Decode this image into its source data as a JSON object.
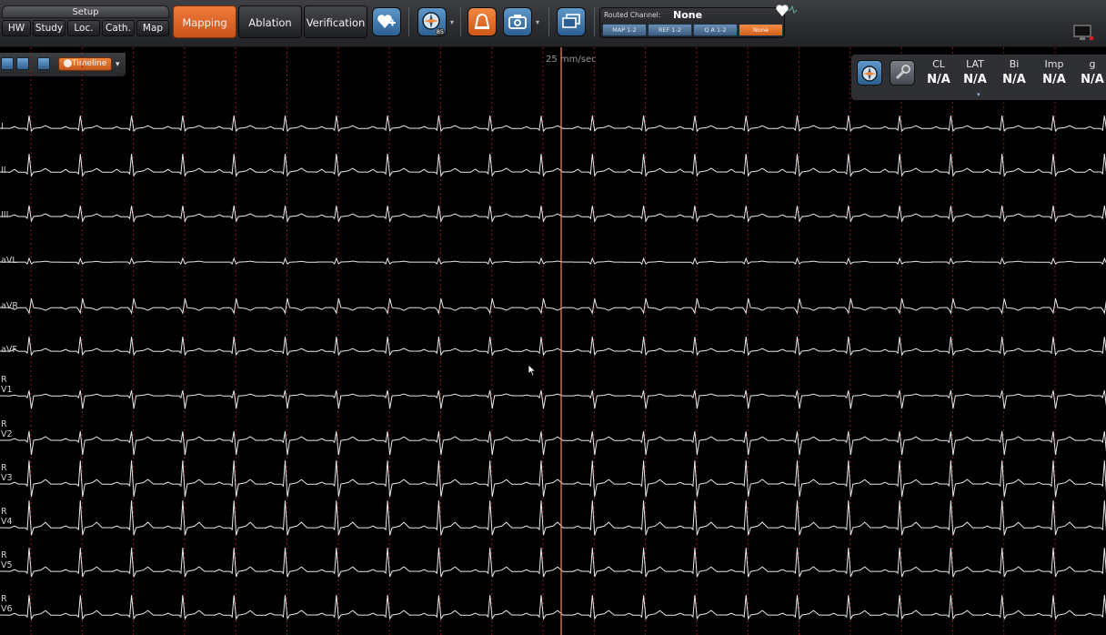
{
  "toolbar": {
    "setup_title": "Setup",
    "setup_buttons": [
      "HW",
      "Study",
      "Loc.",
      "Cath.",
      "Map"
    ],
    "tabs": [
      "Mapping",
      "Ablation",
      "Verification"
    ],
    "active_tab": "Mapping",
    "badge_number": "85",
    "routed_channel": {
      "label": "Routed Channel:",
      "value": "None",
      "tabs": [
        "MAP 1-2",
        "REF 1-2",
        "Q A 1-2",
        "None"
      ]
    }
  },
  "subbar": {
    "timeline_label": "Timeline"
  },
  "sweep_speed": "25 mm/sec",
  "readout": {
    "columns": [
      {
        "label": "CL",
        "value": "N/A"
      },
      {
        "label": "LAT",
        "value": "N/A"
      },
      {
        "label": "Bi",
        "value": "N/A"
      },
      {
        "label": "Imp",
        "value": "N/A"
      },
      {
        "label": "g",
        "value": "N/A"
      }
    ]
  },
  "leads": [
    {
      "name": "I",
      "prefix": ""
    },
    {
      "name": "II",
      "prefix": ""
    },
    {
      "name": "III",
      "prefix": ""
    },
    {
      "name": "aVL",
      "prefix": ""
    },
    {
      "name": "aVR",
      "prefix": ""
    },
    {
      "name": "aVF",
      "prefix": ""
    },
    {
      "name": "V1",
      "prefix": "R"
    },
    {
      "name": "V2",
      "prefix": "R"
    },
    {
      "name": "V3",
      "prefix": "R"
    },
    {
      "name": "V4",
      "prefix": "R"
    },
    {
      "name": "V5",
      "prefix": "R"
    },
    {
      "name": "V6",
      "prefix": "R"
    }
  ],
  "colors": {
    "accent": "#e0672a",
    "trace": "#e8e8e8",
    "grid_marker": "#8a1a1a",
    "sweep_line": "#f08a6a"
  }
}
